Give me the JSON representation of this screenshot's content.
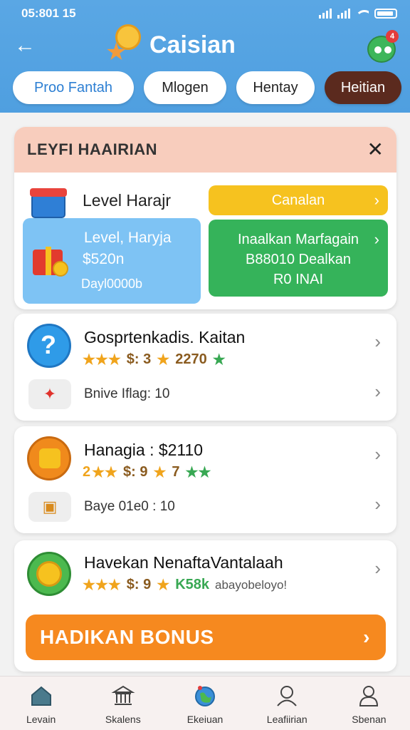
{
  "status": {
    "time": "05:801 15"
  },
  "header": {
    "title": "Caisian"
  },
  "tabs": [
    {
      "label": "Proo Fantah"
    },
    {
      "label": "Mlogen"
    },
    {
      "label": "Hentay"
    },
    {
      "label": "Heitian"
    }
  ],
  "panel": {
    "title": "LEYFI HAAIRIAN",
    "level_title": "Level Harajr",
    "yellow_button": "Canalan",
    "blue_card": {
      "line1": "Level, Haryja",
      "line2": "$520n",
      "line3": "Dayl0000b"
    },
    "green_card": {
      "line1": "Inaalkan Marfagain",
      "line2": "B88010 Dealkan",
      "line3": "R0 INAI"
    }
  },
  "cards": [
    {
      "title": "Gosprtenkadis. Kaitan",
      "rating_text": "$: 3",
      "rating_extra": "2270",
      "sub_text": "Bnive Iflag:  10"
    },
    {
      "title": "Hanagia : $2110",
      "rating_prefix": "2",
      "rating_text": "$: 9",
      "rating_extra": "7",
      "sub_text": "Baye 01e0 :  10"
    },
    {
      "title": "Havekan NenaftaVantalaah",
      "rating_text": "$: 9",
      "rating_green": "K58k",
      "rating_extra": "abayobeloyo!"
    }
  ],
  "bonus_button": "HADIKAN BONUS",
  "nav": [
    {
      "label": "Levain"
    },
    {
      "label": "Skalens"
    },
    {
      "label": "Ekeiuan"
    },
    {
      "label": "Leafiirian"
    },
    {
      "label": "Sbenan"
    }
  ]
}
